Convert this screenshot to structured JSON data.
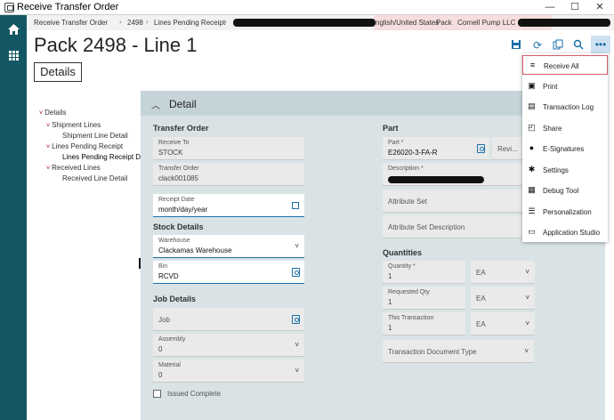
{
  "window": {
    "title": "Receive Transfer Order",
    "minimize": "—",
    "maximize": "☐",
    "close": "✕"
  },
  "breadcrumb": {
    "items": [
      "Receive Transfer Order",
      "2498",
      "Lines Pending Receipt"
    ],
    "right": [
      "nglish/United States",
      "Pack",
      "Cornell Pump LLC"
    ]
  },
  "page": {
    "title": "Pack 2498 - Line 1",
    "tab": "Details"
  },
  "tree": {
    "items": [
      {
        "label": "Details"
      },
      {
        "label": "Shipment Lines"
      },
      {
        "label": "Shipment Line Detail"
      },
      {
        "label": "Lines Pending Receipt"
      },
      {
        "label": "Lines Pending Receipt Detail"
      },
      {
        "label": "Received Lines"
      },
      {
        "label": "Received Line Detail"
      }
    ]
  },
  "detail": {
    "header": "Detail",
    "transfer_order": {
      "section": "Transfer Order",
      "receive_to_label": "Receive To",
      "receive_to_value": "STOCK",
      "transfer_order_label": "Transfer Order",
      "transfer_order_value": "clack001085",
      "receipt_date_label": "Receipt Date",
      "receipt_date_value": "month/day/year"
    },
    "stock": {
      "section": "Stock Details",
      "warehouse_label": "Warehouse",
      "warehouse_value": "Clackamas Warehouse",
      "bin_label": "Bin",
      "bin_value": "RCVD"
    },
    "job": {
      "section": "Job Details",
      "job_placeholder": "Job",
      "assembly_label": "Assembly",
      "assembly_value": "0",
      "material_label": "Material",
      "material_value": "0",
      "issued_complete": "Issued Complete"
    },
    "part": {
      "section": "Part",
      "part_label": "Part *",
      "part_value": "E26020-3-FA-R",
      "revision_placeholder": "Revi...",
      "description_label": "Description *",
      "attribute_set": "Attribute Set",
      "attribute_set_description": "Attribute Set Description"
    },
    "quantities": {
      "section": "Quantities",
      "quantity_label": "Quantity *",
      "quantity_value": "1",
      "quantity_uom": "EA",
      "requested_label": "Requested Qty",
      "requested_value": "1",
      "requested_uom": "EA",
      "this_transaction_label": "This Transaction",
      "this_transaction_value": "1",
      "this_transaction_uom": "EA",
      "transaction_doc_type": "Transaction Document Type"
    }
  },
  "menu": {
    "items": [
      {
        "label": "Receive All",
        "icon": "receive-all-icon"
      },
      {
        "label": "Print",
        "icon": "print-icon"
      },
      {
        "label": "Transaction Log",
        "icon": "transaction-log-icon"
      },
      {
        "label": "Share",
        "icon": "share-icon"
      },
      {
        "label": "E-Signatures",
        "icon": "esignature-icon"
      },
      {
        "label": "Settings",
        "icon": "settings-icon"
      },
      {
        "label": "Debug Tool",
        "icon": "debug-tool-icon"
      },
      {
        "label": "Personalization",
        "icon": "personalization-icon"
      },
      {
        "label": "Application Studio",
        "icon": "application-studio-icon"
      }
    ]
  },
  "colors": {
    "rail": "#145764",
    "accent": "#1a6fa8",
    "panel": "#d9e3e6",
    "highlight": "#d95a6a"
  }
}
